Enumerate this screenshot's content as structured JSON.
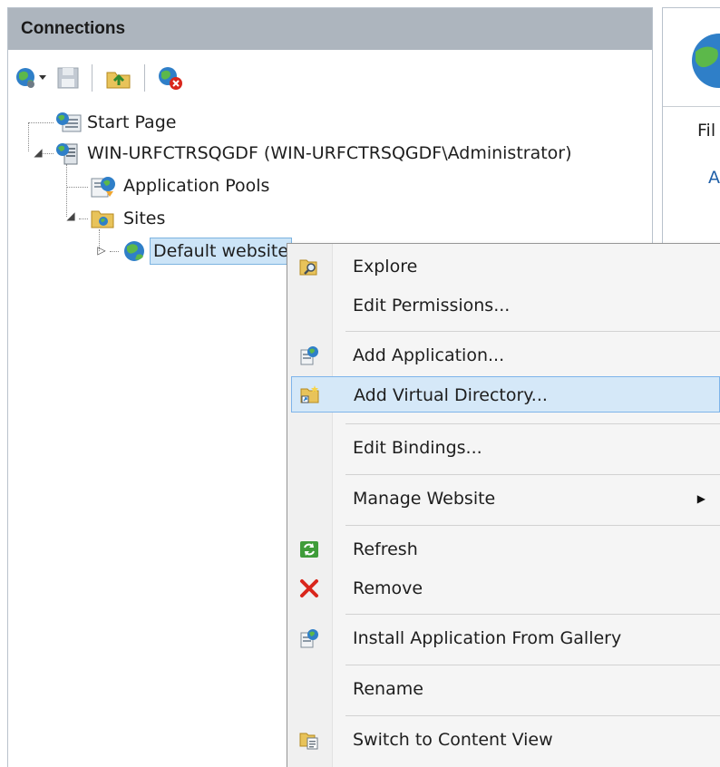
{
  "connections": {
    "title": "Connections",
    "toolbar": [
      {
        "name": "connect-icon",
        "interactable": true
      },
      {
        "name": "save-icon",
        "interactable": true
      },
      {
        "name": "up-level-icon",
        "interactable": true
      },
      {
        "name": "disconnect-icon",
        "interactable": true
      }
    ],
    "tree": {
      "start_page": "Start Page",
      "server": "WIN-URFCTRSQGDF (WIN-URFCTRSQGDF\\Administrator)",
      "app_pools": "Application Pools",
      "sites": "Sites",
      "default_site": "Default website"
    }
  },
  "right_pane": {
    "header_text": "Fil",
    "link_text": "A"
  },
  "context_menu": {
    "items": [
      {
        "label": "Explore",
        "icon": "explore-folder-icon"
      },
      {
        "label": "Edit Permissions...",
        "icon": ""
      },
      {
        "label": "Add Application...",
        "icon": "add-application-icon"
      },
      {
        "label": "Add Virtual Directory...",
        "icon": "add-virtual-directory-icon",
        "highlighted": true
      },
      {
        "label": "Edit Bindings...",
        "icon": ""
      },
      {
        "label": "Manage Website",
        "icon": "",
        "submenu": true
      },
      {
        "label": "Refresh",
        "icon": "refresh-icon"
      },
      {
        "label": "Remove",
        "icon": "remove-icon"
      },
      {
        "label": "Install Application From Gallery",
        "icon": "install-gallery-icon"
      },
      {
        "label": "Rename",
        "icon": ""
      },
      {
        "label": "Switch to Content View",
        "icon": "content-view-icon"
      }
    ],
    "submenu_arrow": "▶"
  },
  "colors": {
    "header_bg": "#adb5be",
    "menu_highlight": "#d5e8f8",
    "menu_highlight_border": "#7eb4ea",
    "selected_node": "#cce4f7",
    "remove_red": "#d9261c"
  }
}
